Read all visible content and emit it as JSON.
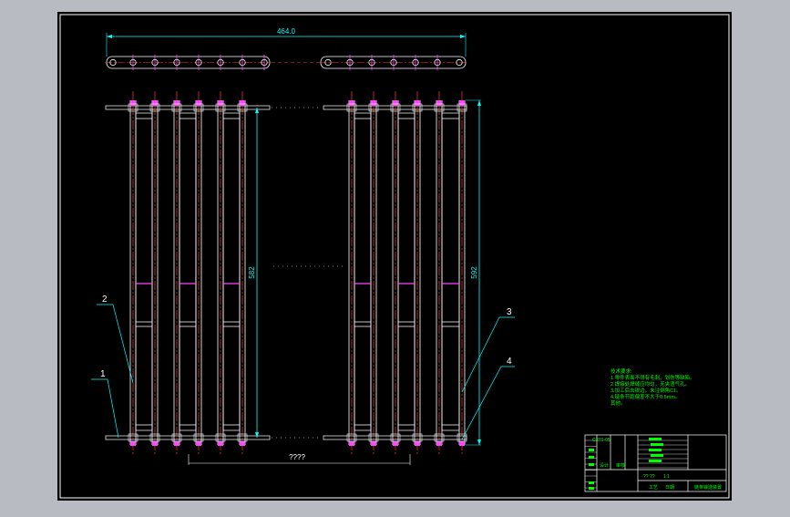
{
  "colors": {
    "viewport": "#b8bcc2",
    "paper": "#000000",
    "border": "#ffffff",
    "frame": "#ffffff",
    "dim": "#00ffff",
    "center": "#ff3333",
    "joint": "#ff44ff",
    "leader": "#00ffff",
    "balloon_text": "#ffffff",
    "notes": "#00ff00",
    "titleblock": "#00ff00"
  },
  "dimensions": {
    "top_width": "464.0",
    "left_height": "582",
    "right_height": "592",
    "bottom_span": "????"
  },
  "balloons": {
    "b1": "1",
    "b2": "2",
    "b3": "3",
    "b4": "4"
  },
  "tech_notes": {
    "heading": "技术要求:",
    "line1": "1.零件表面不得有毛刺、划伤等缺陷。",
    "line2": "2.焊接处焊缝应均匀，无夹渣气孔。",
    "line3": "3.加工后去锐边，未注倒角C1。",
    "line4": "4.链条节距偏差不大于0.5mm。",
    "line5": "其他。"
  },
  "title_block": {
    "code": "CX01-05",
    "mid_label": "?? ??",
    "scale_label": "1:1",
    "drawing_name": "链条输送装置",
    "row_label_a": "设计",
    "row_label_b": "审核",
    "row_label_c": "工艺",
    "row_label_d": "日期"
  }
}
